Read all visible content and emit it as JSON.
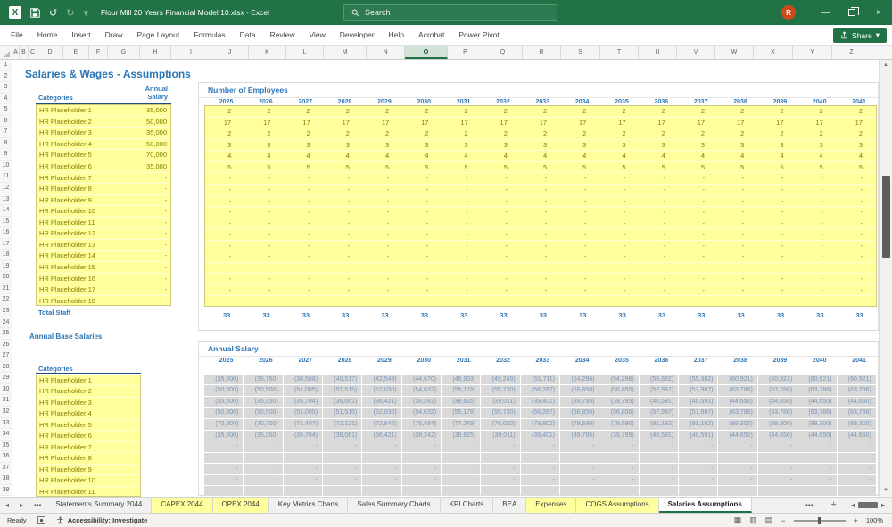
{
  "title_bar": {
    "document_title": "Flour Mill 20 Years Financial Model 10.xlsx  -  Excel",
    "search_placeholder": "Search",
    "avatar_initial": "R"
  },
  "ribbon": {
    "tabs": [
      "File",
      "Home",
      "Insert",
      "Draw",
      "Page Layout",
      "Formulas",
      "Data",
      "Review",
      "View",
      "Developer",
      "Help",
      "Acrobat",
      "Power Pivot"
    ],
    "share_label": "Share"
  },
  "columns": {
    "headers": [
      "A",
      "B",
      "C",
      "D",
      "E",
      "F",
      "G",
      "H",
      "I",
      "J",
      "K",
      "L",
      "M",
      "N",
      "O",
      "P",
      "Q",
      "R",
      "S",
      "T",
      "U",
      "V",
      "W",
      "X",
      "Y",
      "Z"
    ],
    "selected": "O"
  },
  "rows": {
    "first": 1,
    "last": 39
  },
  "sheet": {
    "page_title": "Salaries & Wages - Assumptions",
    "years": [
      "2025",
      "2026",
      "2027",
      "2028",
      "2029",
      "2030",
      "2031",
      "2032",
      "2033",
      "2034",
      "2035",
      "2036",
      "2037",
      "2038",
      "2039",
      "2040",
      "2041"
    ],
    "staff_table": {
      "categories_header": "Categories",
      "salary_header_line1": "Annual",
      "salary_header_line2": "Salary",
      "rows": [
        {
          "label": "HR Placeholder 1",
          "salary": "35,000"
        },
        {
          "label": "HR Placeholder 2",
          "salary": "50,000"
        },
        {
          "label": "HR Placeholder 3",
          "salary": "35,000"
        },
        {
          "label": "HR Placeholder 4",
          "salary": "50,000"
        },
        {
          "label": "HR Placeholder 5",
          "salary": "70,000"
        },
        {
          "label": "HR Placeholder 6",
          "salary": "35,000"
        },
        {
          "label": "HR Placeholder 7",
          "salary": "-"
        },
        {
          "label": "HR Placeholder 8",
          "salary": "-"
        },
        {
          "label": "HR Placeholder 9",
          "salary": "-"
        },
        {
          "label": "HR Placeholder 10",
          "salary": "-"
        },
        {
          "label": "HR Placeholder 11",
          "salary": "-"
        },
        {
          "label": "HR Placeholder 12",
          "salary": "-"
        },
        {
          "label": "HR Placeholder 13",
          "salary": "-"
        },
        {
          "label": "HR Placeholder 14",
          "salary": "-"
        },
        {
          "label": "HR Placeholder 15",
          "salary": "-"
        },
        {
          "label": "HR Placeholder 16",
          "salary": "-"
        },
        {
          "label": "HR Placeholder 17",
          "salary": "-"
        },
        {
          "label": "HR Placeholder 18",
          "salary": "-"
        }
      ],
      "total_label": "Total Staff"
    },
    "employees": {
      "title": "Number of Employees",
      "rows": [
        [
          2,
          2,
          2,
          2,
          2,
          2,
          2,
          2,
          2,
          2,
          2,
          2,
          2,
          2,
          2,
          2,
          2
        ],
        [
          17,
          17,
          17,
          17,
          17,
          17,
          17,
          17,
          17,
          17,
          17,
          17,
          17,
          17,
          17,
          17,
          17
        ],
        [
          2,
          2,
          2,
          2,
          2,
          2,
          2,
          2,
          2,
          2,
          2,
          2,
          2,
          2,
          2,
          2,
          2
        ],
        [
          3,
          3,
          3,
          3,
          3,
          3,
          3,
          3,
          3,
          3,
          3,
          3,
          3,
          3,
          3,
          3,
          3
        ],
        [
          4,
          4,
          4,
          4,
          4,
          4,
          4,
          4,
          4,
          4,
          4,
          4,
          4,
          4,
          4,
          4,
          4
        ],
        [
          5,
          5,
          5,
          5,
          5,
          5,
          5,
          5,
          5,
          5,
          5,
          5,
          5,
          5,
          5,
          5,
          5
        ]
      ],
      "empty_row_count": 12,
      "empty_cell": "-",
      "totals": [
        33,
        33,
        33,
        33,
        33,
        33,
        33,
        33,
        33,
        33,
        33,
        33,
        33,
        33,
        33,
        33,
        33
      ]
    },
    "base_salaries": {
      "title": "Annual Base Salaries",
      "categories_header": "Categories",
      "labels": [
        "HR Placeholder 1",
        "HR Placeholder 2",
        "HR Placeholder 3",
        "HR Placeholder 4",
        "HR Placeholder 5",
        "HR Placeholder 6",
        "HR Placeholder 7",
        "HR Placeholder 8",
        "HR Placeholder 9",
        "HR Placeholder 10",
        "HR Placeholder 11"
      ]
    },
    "annual_salary": {
      "title": "Annual Salary",
      "rows": [
        [
          "(35,000)",
          "(36,750)",
          "(38,588)",
          "(40,517)",
          "(42,543)",
          "(44,670)",
          "(46,903)",
          "(49,249)",
          "(51,711)",
          "(54,296)",
          "(54,296)",
          "(55,382)",
          "(55,382)",
          "(60,921)",
          "(60,921)",
          "(60,921)",
          "(60,921)"
        ],
        [
          "(50,000)",
          "(50,500)",
          "(51,005)",
          "(51,515)",
          "(52,030)",
          "(54,632)",
          "(55,178)",
          "(55,730)",
          "(56,287)",
          "(56,850)",
          "(56,850)",
          "(57,987)",
          "(57,987)",
          "(63,786)",
          "(63,786)",
          "(63,786)",
          "(63,786)"
        ],
        [
          "(35,000)",
          "(35,350)",
          "(35,704)",
          "(36,061)",
          "(36,421)",
          "(38,242)",
          "(38,625)",
          "(39,011)",
          "(39,401)",
          "(39,795)",
          "(39,795)",
          "(40,591)",
          "(40,591)",
          "(44,650)",
          "(44,650)",
          "(44,650)",
          "(44,650)"
        ],
        [
          "(50,000)",
          "(50,500)",
          "(51,005)",
          "(51,515)",
          "(52,030)",
          "(54,632)",
          "(55,178)",
          "(55,730)",
          "(56,287)",
          "(56,850)",
          "(56,850)",
          "(57,987)",
          "(57,987)",
          "(63,786)",
          "(63,786)",
          "(63,786)",
          "(63,786)"
        ],
        [
          "(70,000)",
          "(70,700)",
          "(71,407)",
          "(72,121)",
          "(72,842)",
          "(76,484)",
          "(77,249)",
          "(78,022)",
          "(78,802)",
          "(79,590)",
          "(79,590)",
          "(81,182)",
          "(81,182)",
          "(89,300)",
          "(89,300)",
          "(89,300)",
          "(89,300)"
        ],
        [
          "(35,000)",
          "(35,350)",
          "(35,704)",
          "(36,061)",
          "(36,421)",
          "(38,242)",
          "(38,625)",
          "(39,011)",
          "(39,401)",
          "(39,795)",
          "(39,795)",
          "(40,591)",
          "(40,591)",
          "(44,650)",
          "(44,650)",
          "(44,650)",
          "(44,650)"
        ]
      ],
      "empty_row_count": 5,
      "empty_cell": "-"
    }
  },
  "tab_bar": {
    "tabs": [
      {
        "label": "Statements Summary 2044",
        "highlight": false,
        "active": false
      },
      {
        "label": "CAPEX 2044",
        "highlight": true,
        "active": false
      },
      {
        "label": "OPEX 2044",
        "highlight": true,
        "active": false
      },
      {
        "label": "Key Metrics Charts",
        "highlight": false,
        "active": false
      },
      {
        "label": "Sales Summary Charts",
        "highlight": false,
        "active": false
      },
      {
        "label": "KPI Charts",
        "highlight": false,
        "active": false
      },
      {
        "label": "BEA",
        "highlight": false,
        "active": false
      },
      {
        "label": "Expenses",
        "highlight": true,
        "active": false
      },
      {
        "label": "COGS Assumptions",
        "highlight": true,
        "active": false
      },
      {
        "label": "Salaries Assumptions",
        "highlight": false,
        "active": true
      }
    ]
  },
  "status_bar": {
    "ready_label": "Ready",
    "accessibility_label": "Accessibility: Investigate",
    "zoom_level": "100%"
  },
  "icons": {
    "undo": "↺",
    "redo": "↻",
    "qat_dropdown": "▾",
    "minimize": "—",
    "close": "×",
    "tab_prev": "◂",
    "tab_next": "▸",
    "tab_list": "•••",
    "sheet_more": "•••",
    "add_sheet": "+",
    "hs_left": "◂",
    "hs_right": "▸",
    "scroll_up": "▲",
    "scroll_down": "▼",
    "view_normal": "▦",
    "view_layout": "▥",
    "view_break": "▤",
    "zoom_out": "−",
    "zoom_in": "+"
  }
}
